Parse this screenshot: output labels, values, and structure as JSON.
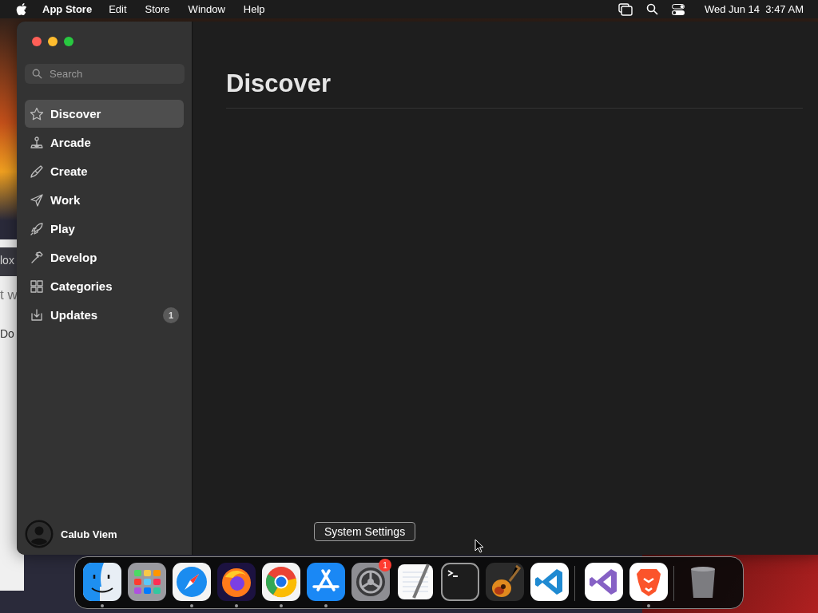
{
  "menu_bar": {
    "app_name": "App Store",
    "menus": [
      "Edit",
      "Store",
      "Window",
      "Help"
    ],
    "clock": "Wed Jun 14  3:47 AM"
  },
  "background_window": {
    "texts": [
      "lox",
      "t w",
      "Do"
    ]
  },
  "sidebar": {
    "search": {
      "placeholder": "Search"
    },
    "items": [
      {
        "label": "Discover",
        "kind": "star",
        "selected": true
      },
      {
        "label": "Arcade",
        "kind": "joystick",
        "selected": false
      },
      {
        "label": "Create",
        "kind": "brush",
        "selected": false
      },
      {
        "label": "Work",
        "kind": "plane",
        "selected": false
      },
      {
        "label": "Play",
        "kind": "rocket",
        "selected": false
      },
      {
        "label": "Develop",
        "kind": "hammer",
        "selected": false
      },
      {
        "label": "Categories",
        "kind": "grid",
        "selected": false
      },
      {
        "label": "Updates",
        "kind": "download",
        "selected": false,
        "badge": "1"
      }
    ],
    "account": {
      "name": "Calub Viem"
    }
  },
  "main": {
    "title": "Discover"
  },
  "tooltip": "System Settings",
  "dock": {
    "groups": [
      [
        {
          "kind": "finder",
          "running": true
        },
        {
          "kind": "launchpad",
          "running": false
        },
        {
          "kind": "safari",
          "running": true
        },
        {
          "kind": "firefox",
          "running": true
        },
        {
          "kind": "chrome",
          "running": true
        },
        {
          "kind": "appstore",
          "running": true
        },
        {
          "kind": "settings",
          "running": false,
          "badge": "1"
        },
        {
          "kind": "textedit",
          "running": false
        },
        {
          "kind": "terminal",
          "running": false
        },
        {
          "kind": "guitar",
          "running": false
        },
        {
          "kind": "vscode",
          "running": false
        }
      ],
      [
        {
          "kind": "visualstudio",
          "running": false
        },
        {
          "kind": "brave",
          "running": true
        }
      ],
      [
        {
          "kind": "trash",
          "running": false
        }
      ]
    ]
  }
}
